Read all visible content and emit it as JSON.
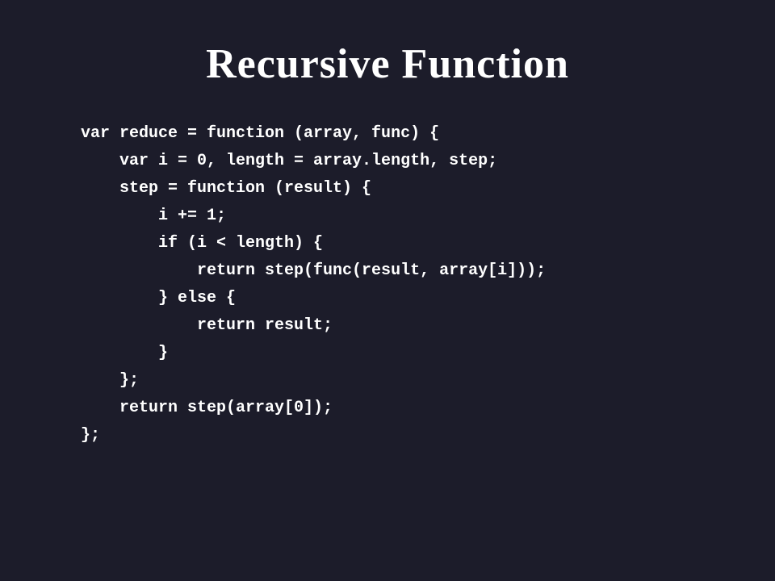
{
  "page": {
    "background_color": "#1c1c2a",
    "title": "Recursive Function",
    "code": {
      "lines": [
        "var reduce = function (array, func) {",
        "    var i = 0, length = array.length, step;",
        "    step = function (result) {",
        "        i += 1;",
        "        if (i < length) {",
        "            return step(func(result, array[i]));",
        "        } else {",
        "            return result;",
        "        }",
        "    };",
        "    return step(array[0]);",
        "};"
      ]
    }
  }
}
